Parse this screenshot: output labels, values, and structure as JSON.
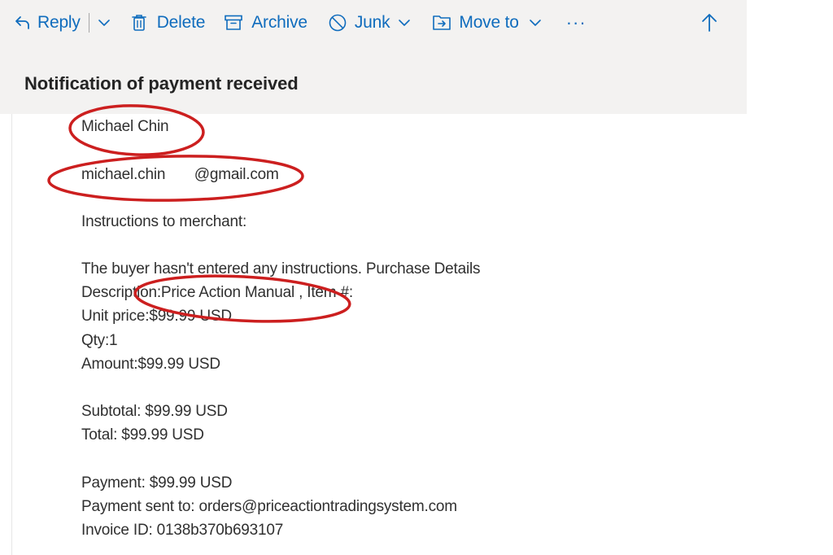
{
  "toolbar": {
    "reply_label": "Reply",
    "delete_label": "Delete",
    "archive_label": "Archive",
    "junk_label": "Junk",
    "move_label": "Move to",
    "more_label": "···"
  },
  "message": {
    "subject": "Notification of payment received",
    "sender_name": "Michael Chin",
    "sender_email": "michael.chin       @gmail.com",
    "instructions_heading": "Instructions to merchant:",
    "instructions_text": "The buyer hasn't entered any instructions. Purchase Details",
    "description": "Description:Price Action Manual , Item #:",
    "unit_price": "Unit price:$99.99 USD",
    "qty": "Qty:1",
    "amount": "Amount:$99.99 USD",
    "subtotal": "Subtotal: $99.99 USD",
    "total": "Total: $99.99 USD",
    "payment": "Payment: $99.99 USD",
    "payment_sent_to": "Payment sent to: orders@priceactiontradingsystem.com",
    "invoice_id": "Invoice ID: 0138b370b693107"
  },
  "colors": {
    "accent": "#0f6cbd",
    "panel_bg": "#f3f2f1",
    "annotation": "#cc1f1f"
  },
  "icons": [
    "reply-icon",
    "chevron-down-icon",
    "trash-icon",
    "archive-icon",
    "block-icon",
    "move-to-icon",
    "more-icon",
    "arrow-up-icon"
  ]
}
